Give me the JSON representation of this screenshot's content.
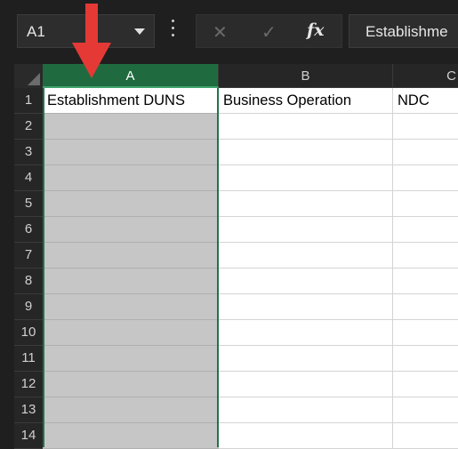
{
  "name_box": {
    "value": "A1"
  },
  "formula_bar": {
    "value": "Establishme"
  },
  "icons": {
    "cancel": "✕",
    "enter": "✓",
    "function": "fx"
  },
  "columns": [
    {
      "label": "A",
      "selected": true
    },
    {
      "label": "B",
      "selected": false
    },
    {
      "label": "C",
      "selected": false
    }
  ],
  "rows": [
    "1",
    "2",
    "3",
    "4",
    "5",
    "6",
    "7",
    "8",
    "9",
    "10",
    "11",
    "12",
    "13",
    "14"
  ],
  "cells": {
    "A1": "Establishment DUNS",
    "B1": "Business Operation",
    "C1": "NDC"
  },
  "colors": {
    "selection_header": "#1f6b3f",
    "selection_border": "#21744a",
    "annotation_arrow": "#e53935"
  }
}
